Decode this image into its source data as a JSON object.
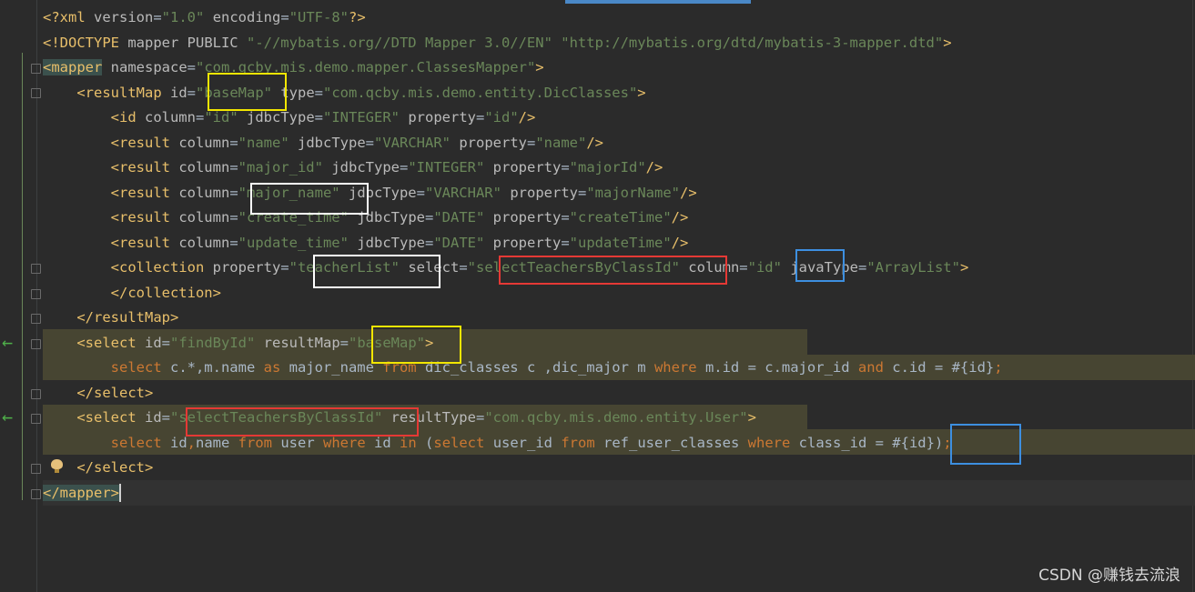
{
  "lines": [
    {
      "segments": [
        [
          "t",
          "<?xml "
        ],
        [
          "a",
          "version"
        ],
        [
          "p",
          "="
        ],
        [
          "v",
          "\"1.0\""
        ],
        [
          "p",
          " "
        ],
        [
          "a",
          "encoding"
        ],
        [
          "p",
          "="
        ],
        [
          "v",
          "\"UTF-8\""
        ],
        [
          "t",
          "?>"
        ]
      ]
    },
    {
      "segments": [
        [
          "t",
          "<!DOCTYPE "
        ],
        [
          "a",
          "mapper PUBLIC "
        ],
        [
          "v",
          "\"-//mybatis.org//DTD Mapper 3.0//EN\" \"http://mybatis.org/dtd/mybatis-3-mapper.dtd\""
        ],
        [
          "t",
          ">"
        ]
      ]
    },
    {
      "segments": [
        [
          "m",
          "<mapper"
        ],
        [
          "p",
          " "
        ],
        [
          "a",
          "namespace"
        ],
        [
          "p",
          "="
        ],
        [
          "v",
          "\"com.qcby.mis.demo.mapper.ClassesMapper\""
        ],
        [
          "t",
          ">"
        ]
      ]
    },
    {
      "segments": [
        [
          "p",
          "    "
        ],
        [
          "t",
          "<resultMap "
        ],
        [
          "a",
          "id"
        ],
        [
          "p",
          "="
        ],
        [
          "v",
          "\"baseMap\""
        ],
        [
          "p",
          " "
        ],
        [
          "a",
          "type"
        ],
        [
          "p",
          "="
        ],
        [
          "v",
          "\"com.qcby.mis.demo.entity.DicClasses\""
        ],
        [
          "t",
          ">"
        ]
      ]
    },
    {
      "segments": [
        [
          "p",
          "        "
        ],
        [
          "t",
          "<id "
        ],
        [
          "a",
          "column"
        ],
        [
          "p",
          "="
        ],
        [
          "v",
          "\"id\""
        ],
        [
          "p",
          " "
        ],
        [
          "a",
          "jdbcType"
        ],
        [
          "p",
          "="
        ],
        [
          "v",
          "\"INTEGER\""
        ],
        [
          "p",
          " "
        ],
        [
          "a",
          "property"
        ],
        [
          "p",
          "="
        ],
        [
          "v",
          "\"id\""
        ],
        [
          "t",
          "/>"
        ]
      ]
    },
    {
      "segments": [
        [
          "p",
          "        "
        ],
        [
          "t",
          "<result "
        ],
        [
          "a",
          "column"
        ],
        [
          "p",
          "="
        ],
        [
          "v",
          "\"name\""
        ],
        [
          "p",
          " "
        ],
        [
          "a",
          "jdbcType"
        ],
        [
          "p",
          "="
        ],
        [
          "v",
          "\"VARCHAR\""
        ],
        [
          "p",
          " "
        ],
        [
          "a",
          "property"
        ],
        [
          "p",
          "="
        ],
        [
          "v",
          "\"name\""
        ],
        [
          "t",
          "/>"
        ]
      ]
    },
    {
      "segments": [
        [
          "p",
          "        "
        ],
        [
          "t",
          "<result "
        ],
        [
          "a",
          "column"
        ],
        [
          "p",
          "="
        ],
        [
          "v",
          "\"major_id\""
        ],
        [
          "p",
          " "
        ],
        [
          "a",
          "jdbcType"
        ],
        [
          "p",
          "="
        ],
        [
          "v",
          "\"INTEGER\""
        ],
        [
          "p",
          " "
        ],
        [
          "a",
          "property"
        ],
        [
          "p",
          "="
        ],
        [
          "v",
          "\"majorId\""
        ],
        [
          "t",
          "/>"
        ]
      ]
    },
    {
      "segments": [
        [
          "p",
          "        "
        ],
        [
          "t",
          "<result "
        ],
        [
          "a",
          "column"
        ],
        [
          "p",
          "="
        ],
        [
          "v",
          "\"major_name\""
        ],
        [
          "p",
          " "
        ],
        [
          "a",
          "jdbcType"
        ],
        [
          "p",
          "="
        ],
        [
          "v",
          "\"VARCHAR\""
        ],
        [
          "p",
          " "
        ],
        [
          "a",
          "property"
        ],
        [
          "p",
          "="
        ],
        [
          "v",
          "\"majorName\""
        ],
        [
          "t",
          "/>"
        ]
      ]
    },
    {
      "segments": [
        [
          "p",
          "        "
        ],
        [
          "t",
          "<result "
        ],
        [
          "a",
          "column"
        ],
        [
          "p",
          "="
        ],
        [
          "v",
          "\"create_time\""
        ],
        [
          "p",
          " "
        ],
        [
          "a",
          "jdbcType"
        ],
        [
          "p",
          "="
        ],
        [
          "v",
          "\"DATE\""
        ],
        [
          "p",
          " "
        ],
        [
          "a",
          "property"
        ],
        [
          "p",
          "="
        ],
        [
          "v",
          "\"createTime\""
        ],
        [
          "t",
          "/>"
        ]
      ]
    },
    {
      "segments": [
        [
          "p",
          "        "
        ],
        [
          "t",
          "<result "
        ],
        [
          "a",
          "column"
        ],
        [
          "p",
          "="
        ],
        [
          "v",
          "\"update_time\""
        ],
        [
          "p",
          " "
        ],
        [
          "a",
          "jdbcType"
        ],
        [
          "p",
          "="
        ],
        [
          "v",
          "\"DATE\""
        ],
        [
          "p",
          " "
        ],
        [
          "a",
          "property"
        ],
        [
          "p",
          "="
        ],
        [
          "v",
          "\"updateTime\""
        ],
        [
          "t",
          "/>"
        ]
      ]
    },
    {
      "segments": [
        [
          "p",
          "        "
        ],
        [
          "t",
          "<collection "
        ],
        [
          "a",
          "property"
        ],
        [
          "p",
          "="
        ],
        [
          "v",
          "\"teacherList\""
        ],
        [
          "p",
          " "
        ],
        [
          "a",
          "select"
        ],
        [
          "p",
          "="
        ],
        [
          "v",
          "\"selectTeachersByClassId\""
        ],
        [
          "p",
          " "
        ],
        [
          "a",
          "column"
        ],
        [
          "p",
          "="
        ],
        [
          "v",
          "\"id\""
        ],
        [
          "p",
          " "
        ],
        [
          "a",
          "javaType"
        ],
        [
          "p",
          "="
        ],
        [
          "v",
          "\"ArrayList\""
        ],
        [
          "t",
          ">"
        ]
      ]
    },
    {
      "segments": [
        [
          "p",
          "        "
        ],
        [
          "t",
          "</collection>"
        ]
      ]
    },
    {
      "segments": [
        [
          "p",
          "    "
        ],
        [
          "t",
          "</resultMap>"
        ]
      ]
    },
    {
      "segments": [
        [
          "p",
          "    "
        ],
        [
          "t",
          "<select "
        ],
        [
          "a",
          "id"
        ],
        [
          "p",
          "="
        ],
        [
          "v",
          "\"findById\""
        ],
        [
          "p",
          " "
        ],
        [
          "a",
          "resultMap"
        ],
        [
          "p",
          "="
        ],
        [
          "v",
          "\"baseMap\""
        ],
        [
          "t",
          ">"
        ]
      ]
    },
    {
      "segments": [
        [
          "p",
          "        "
        ],
        [
          "k",
          "select "
        ],
        [
          "w",
          "c.*,m.name "
        ],
        [
          "k",
          "as "
        ],
        [
          "w",
          "major_name "
        ],
        [
          "k",
          "from "
        ],
        [
          "w",
          "dic_classes c ,dic_major m "
        ],
        [
          "k",
          "where "
        ],
        [
          "w",
          "m.id = c.major_id "
        ],
        [
          "k",
          "and "
        ],
        [
          "w",
          "c.id = #{id}"
        ],
        [
          "k",
          ";"
        ]
      ]
    },
    {
      "segments": [
        [
          "p",
          "    "
        ],
        [
          "t",
          "</select>"
        ]
      ]
    },
    {
      "segments": [
        [
          "p",
          "    "
        ],
        [
          "t",
          "<select "
        ],
        [
          "a",
          "id"
        ],
        [
          "p",
          "="
        ],
        [
          "v",
          "\"selectTeachersByClassId\""
        ],
        [
          "p",
          " "
        ],
        [
          "a",
          "resultType"
        ],
        [
          "p",
          "="
        ],
        [
          "v",
          "\"com.qcby.mis.demo.entity.User\""
        ],
        [
          "t",
          ">"
        ]
      ]
    },
    {
      "segments": [
        [
          "p",
          "        "
        ],
        [
          "k",
          "select "
        ],
        [
          "w",
          "id"
        ],
        [
          "k",
          ","
        ],
        [
          "w",
          "name "
        ],
        [
          "k",
          "from "
        ],
        [
          "w",
          "user "
        ],
        [
          "k",
          "where "
        ],
        [
          "w",
          "id "
        ],
        [
          "k",
          "in "
        ],
        [
          "w",
          "("
        ],
        [
          "k",
          "select "
        ],
        [
          "w",
          "user_id "
        ],
        [
          "k",
          "from "
        ],
        [
          "w",
          "ref_user_classes "
        ],
        [
          "k",
          "where "
        ],
        [
          "w",
          "class_id = #{id})"
        ],
        [
          "k",
          ";"
        ]
      ]
    },
    {
      "segments": [
        [
          "p",
          "    "
        ],
        [
          "t",
          "</select>"
        ]
      ]
    },
    {
      "segments": [
        [
          "m",
          "</mapper>"
        ],
        [
          "c",
          ""
        ]
      ]
    }
  ],
  "watermark": "CSDN @赚钱去流浪"
}
